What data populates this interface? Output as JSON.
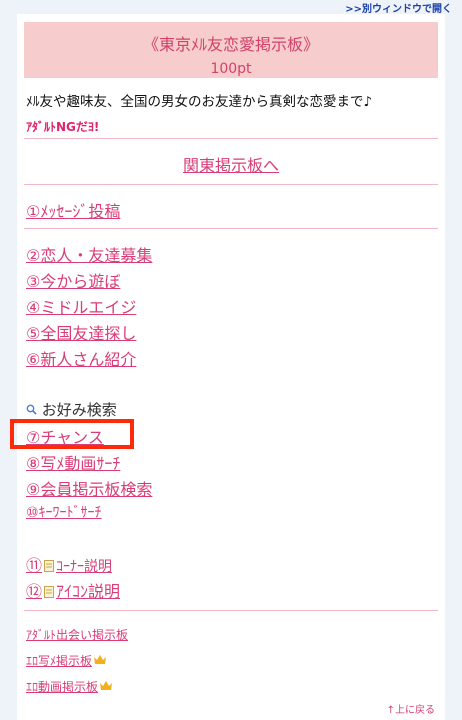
{
  "header": {
    "open_window": ">>別ウィンドウで開く"
  },
  "board": {
    "title": "《東京ﾒﾙ友恋愛掲示板》",
    "points": "100pt",
    "description": "ﾒﾙ友や趣味友、全国の男女のお友達から真剣な恋愛まで♪",
    "adult_note": "ｱﾀﾞﾙﾄNGだﾖ!"
  },
  "kanto_link": "関東掲示板へ",
  "menu": {
    "post": "①ﾒｯｾｰｼﾞ投稿",
    "items": [
      "②恋人・友達募集",
      "③今から遊ぼ",
      "④ミドルエイジ",
      "⑤全国友達探し",
      "⑥新人さん紹介"
    ],
    "search_label": "お好み検索",
    "chance": "⑦チャンス",
    "photo_search": "⑧写ﾒ動画ｻｰﾁ",
    "member_search": "⑨会員掲示板検索",
    "keyword_search": "⑩ｷｰﾜｰﾄﾞｻｰﾁ",
    "corner_num": "⑪",
    "corner": "ｺｰﾅｰ説明",
    "icon_num": "⑫",
    "icon": "ｱｲｺﾝ説明"
  },
  "adult": {
    "meet": "ｱﾀﾞﾙﾄ出会い掲示板",
    "photo": "ｴﾛ写ﾒ掲示板",
    "video": "ｴﾛ動画掲示板"
  },
  "footer": {
    "back_top": "↑上に戻る"
  },
  "colors": {
    "link": "#d83d77",
    "title_bg": "#f6cccc",
    "highlight": "#ff2a0a"
  }
}
